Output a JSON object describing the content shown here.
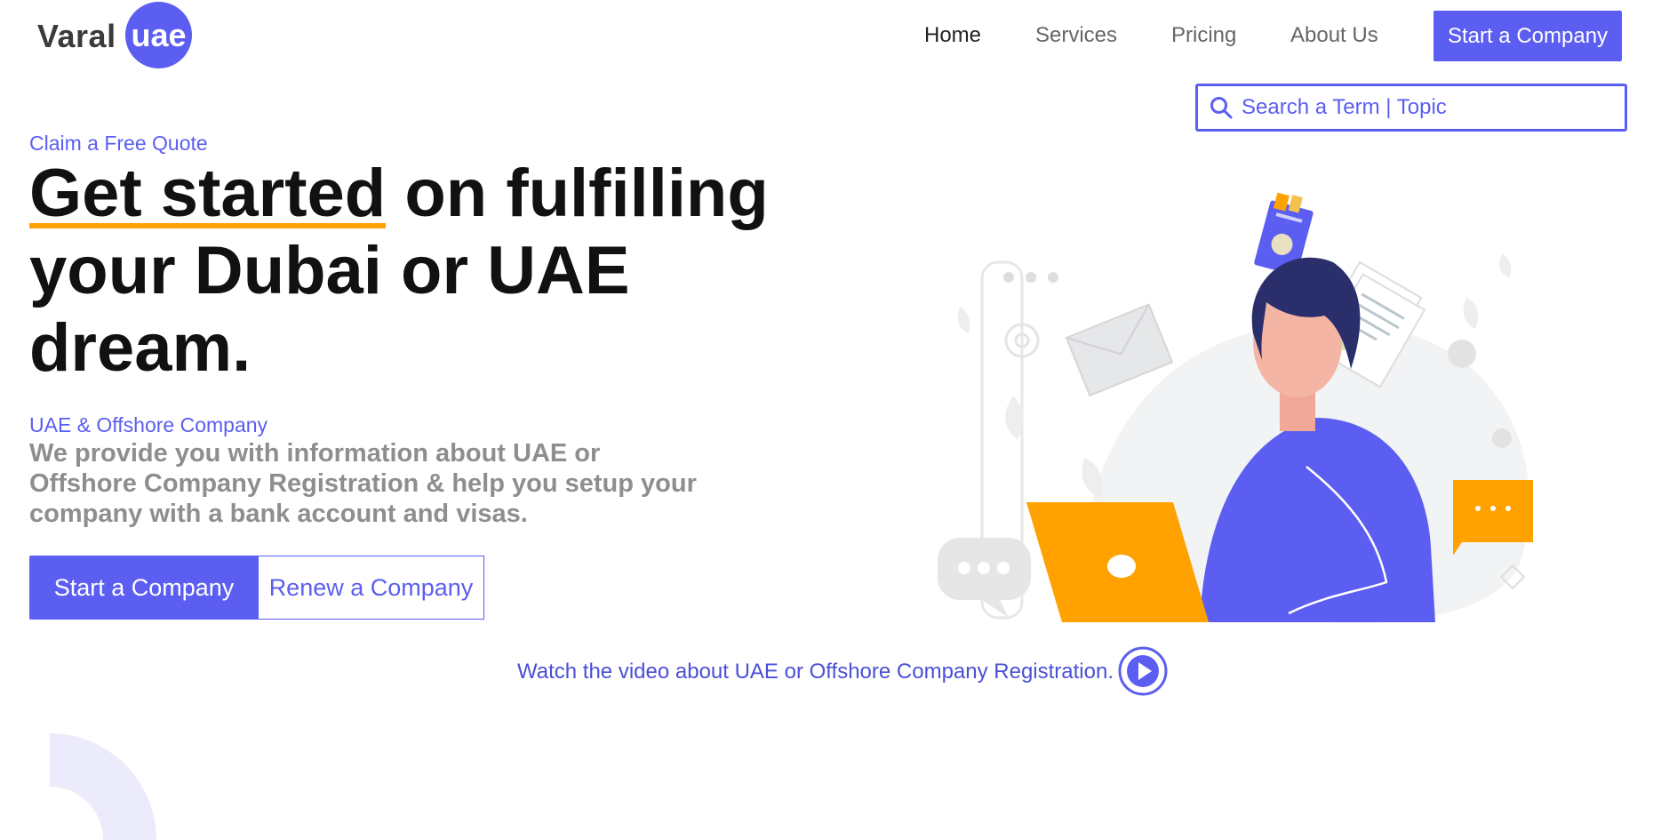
{
  "brand": {
    "name_left": "Varal",
    "name_right": "uae",
    "accent": "#5b5ef0"
  },
  "nav": {
    "home": "Home",
    "services": "Services",
    "pricing": "Pricing",
    "about": "About Us",
    "cta": "Start a Company"
  },
  "search": {
    "placeholder": "Search a Term | Topic",
    "icon": "search-icon"
  },
  "hero": {
    "eyebrow": "Claim a Free Quote",
    "headline_underlined": "Get started",
    "headline_rest": " on fulfilling your Dubai or UAE dream.",
    "sub_eyebrow": "UAE & Offshore Company",
    "lead": "We provide you with information about UAE or Offshore Company Registration & help you setup your company with a bank account and visas.",
    "primary_button": "Start a Company",
    "secondary_button": "Renew a Company",
    "underline_color": "#ffa200"
  },
  "video": {
    "text": "Watch the video about UAE or Offshore Company Registration.",
    "icon": "play-icon"
  }
}
